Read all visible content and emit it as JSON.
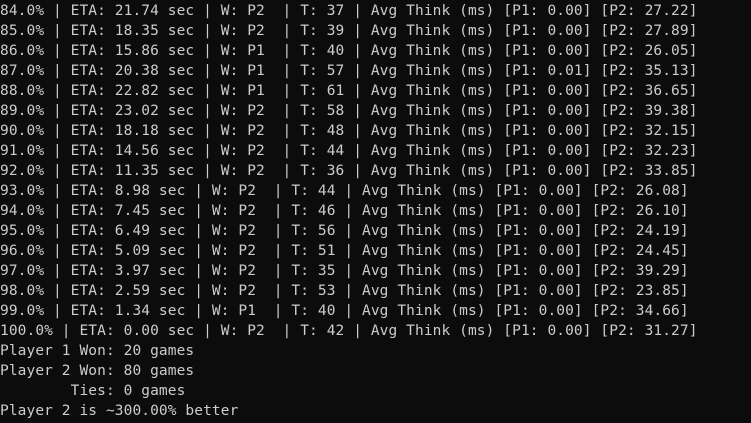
{
  "terminal": {
    "lines": [
      "84.0% | ETA: 21.74 sec | W: P2  | T: 37 | Avg Think (ms) [P1: 0.00] [P2: 27.22]",
      "85.0% | ETA: 18.35 sec | W: P2  | T: 39 | Avg Think (ms) [P1: 0.00] [P2: 27.89]",
      "86.0% | ETA: 15.86 sec | W: P1  | T: 40 | Avg Think (ms) [P1: 0.00] [P2: 26.05]",
      "87.0% | ETA: 20.38 sec | W: P1  | T: 57 | Avg Think (ms) [P1: 0.01] [P2: 35.13]",
      "88.0% | ETA: 22.82 sec | W: P1  | T: 61 | Avg Think (ms) [P1: 0.00] [P2: 36.65]",
      "89.0% | ETA: 23.02 sec | W: P2  | T: 58 | Avg Think (ms) [P1: 0.00] [P2: 39.38]",
      "90.0% | ETA: 18.18 sec | W: P2  | T: 48 | Avg Think (ms) [P1: 0.00] [P2: 32.15]",
      "91.0% | ETA: 14.56 sec | W: P2  | T: 44 | Avg Think (ms) [P1: 0.00] [P2: 32.23]",
      "92.0% | ETA: 11.35 sec | W: P2  | T: 36 | Avg Think (ms) [P1: 0.00] [P2: 33.85]",
      "93.0% | ETA: 8.98 sec | W: P2  | T: 44 | Avg Think (ms) [P1: 0.00] [P2: 26.08]",
      "94.0% | ETA: 7.45 sec | W: P2  | T: 46 | Avg Think (ms) [P1: 0.00] [P2: 26.10]",
      "95.0% | ETA: 6.49 sec | W: P2  | T: 56 | Avg Think (ms) [P1: 0.00] [P2: 24.19]",
      "96.0% | ETA: 5.09 sec | W: P2  | T: 51 | Avg Think (ms) [P1: 0.00] [P2: 24.45]",
      "97.0% | ETA: 3.97 sec | W: P2  | T: 35 | Avg Think (ms) [P1: 0.00] [P2: 39.29]",
      "98.0% | ETA: 2.59 sec | W: P2  | T: 53 | Avg Think (ms) [P1: 0.00] [P2: 23.85]",
      "99.0% | ETA: 1.34 sec | W: P1  | T: 40 | Avg Think (ms) [P1: 0.00] [P2: 34.66]",
      "100.0% | ETA: 0.00 sec | W: P2  | T: 42 | Avg Think (ms) [P1: 0.00] [P2: 31.27]",
      "Player 1 Won: 20 games",
      "Player 2 Won: 80 games",
      "        Ties: 0 games",
      "Player 2 is ~300.00% better"
    ],
    "colors": {
      "background": "#0c0c0c",
      "text": "#cccccc"
    }
  }
}
